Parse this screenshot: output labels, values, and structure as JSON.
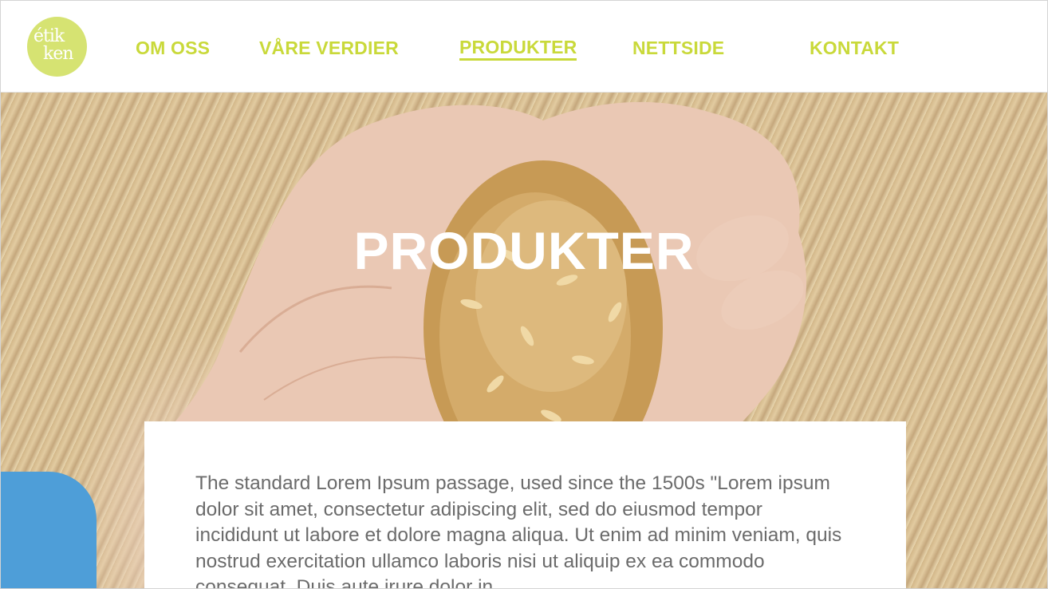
{
  "logo": {
    "line1": "étik",
    "line2": "ken"
  },
  "nav": {
    "items": [
      {
        "label": "OM OSS"
      },
      {
        "label": "VÅRE VERDIER"
      },
      {
        "label": "PRODUKTER",
        "active": true
      },
      {
        "label": "NETTSIDE"
      },
      {
        "label": "KONTAKT"
      }
    ]
  },
  "hero": {
    "title": "PRODUKTER"
  },
  "content": {
    "text": "The standard Lorem Ipsum passage, used since the 1500s \"Lorem ipsum dolor sit amet, consectetur adipiscing elit, sed do eiusmod tempor incididunt ut labore et dolore magna aliqua. Ut enim ad minim veniam, quis nostrud exercitation ullamco laboris nisi ut aliquip ex ea commodo consequat. Duis aute irure dolor in"
  },
  "colors": {
    "accent": "#c9d93a",
    "logo_bg": "#d6e372",
    "body_text": "#6b6b6b"
  }
}
